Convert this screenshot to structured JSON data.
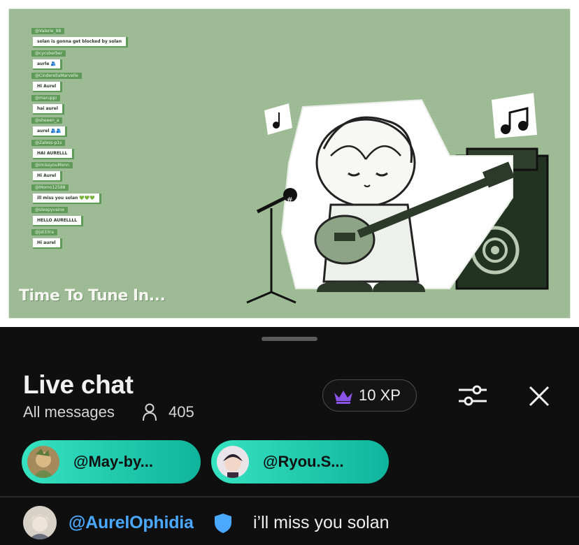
{
  "video": {
    "title": "Time To Tune In...",
    "overlay_messages": [
      {
        "user": "@Valerie_98",
        "text": "solan is gonna get blocked by solan"
      },
      {
        "user": "@cycsberber",
        "text": "aurle 🫂"
      },
      {
        "user": "@CinderellaMarvelle",
        "text": "Hi Aurel"
      },
      {
        "user": "@maruppi",
        "text": "hai aurel"
      },
      {
        "user": "@sheeen_a",
        "text": "aurel 🫂🫂"
      },
      {
        "user": "@Zaless-p1s",
        "text": "HAI AURELLL"
      },
      {
        "user": "@imissyouMonn",
        "text": "Hi Aurel"
      },
      {
        "user": "@Momo12588",
        "text": "ill miss you solan 💚💚💚"
      },
      {
        "user": "@sleepyvaine",
        "text": "HELLO AURELLLL"
      },
      {
        "user": "@jst33ra",
        "text": "Hi aurel"
      }
    ],
    "art_labels": {
      "hash": "#"
    }
  },
  "chat": {
    "title": "Live chat",
    "filter_label": "All messages",
    "viewer_count": "405",
    "xp_label": "10 XP",
    "pinned_chips": [
      {
        "label": "@May-by..."
      },
      {
        "label": "@Ryou.S..."
      }
    ],
    "message": {
      "author": "@AurelOphidia",
      "text": "i’ll miss you solan"
    }
  },
  "colors": {
    "accent_chip_start": "#35e2c1",
    "accent_chip_end": "#10b49c",
    "author_blue": "#4ba8ff",
    "crown_purple": "#8a52e6",
    "video_bg": "#9cba93"
  },
  "icons": [
    "user-icon",
    "crown-icon",
    "filter-sliders-icon",
    "close-icon",
    "shield-icon"
  ]
}
